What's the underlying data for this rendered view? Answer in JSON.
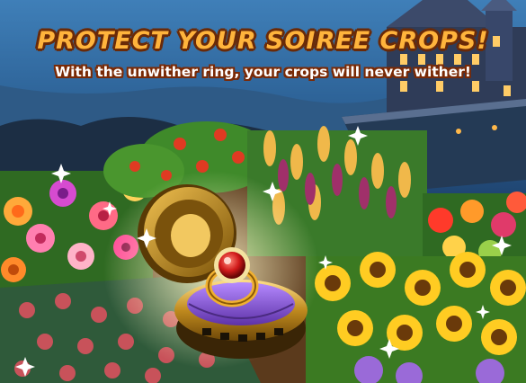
{
  "banner": {
    "headline": "PROTECT YOUR SOIREE CROPS!",
    "subline": "With the unwither ring, your crops will never wither!"
  },
  "item": {
    "icon": "unwither-ring-icon",
    "gem_color": "#d11a1a",
    "box_color": "#c08a1e",
    "cushion_color": "#8a5ad0"
  },
  "colors": {
    "headline": "#ffb43c",
    "outline": "#6a2a08",
    "subline": "#ffffff"
  }
}
